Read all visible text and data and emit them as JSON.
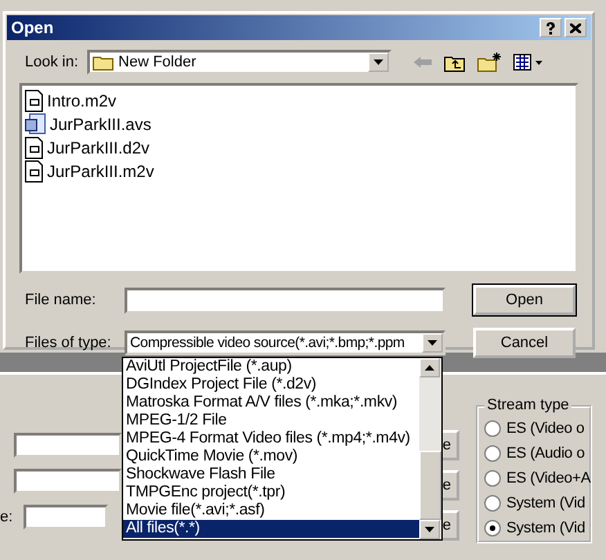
{
  "background_window": {
    "button_labels": [
      "e",
      "e",
      "e"
    ],
    "field_label": "e:",
    "stream_type": {
      "title": "Stream type",
      "options": [
        {
          "label": "ES (Video o",
          "selected": false
        },
        {
          "label": "ES (Audio o",
          "selected": false
        },
        {
          "label": "ES (Video+A",
          "selected": false
        },
        {
          "label": "System (Vid",
          "selected": false
        },
        {
          "label": "System (Vid",
          "selected": true
        }
      ]
    }
  },
  "dialog": {
    "title": "Open",
    "look_in": {
      "label": "Look in:",
      "value": "New Folder"
    },
    "files": [
      {
        "name": "Intro.m2v",
        "kind": "file"
      },
      {
        "name": "JurParkIII.avs",
        "kind": "script"
      },
      {
        "name": "JurParkIII.d2v",
        "kind": "file"
      },
      {
        "name": "JurParkIII.m2v",
        "kind": "file"
      }
    ],
    "file_name": {
      "label": "File name:"
    },
    "files_of_type": {
      "label": "Files of type:",
      "value": "Compressible video source(*.avi;*.bmp;*.ppm"
    },
    "buttons": [
      "Open",
      "Cancel"
    ],
    "type_list": [
      {
        "label": "AviUtl ProjectFile (*.aup)",
        "selected": false
      },
      {
        "label": "DGIndex Project File (*.d2v)",
        "selected": false
      },
      {
        "label": "Matroska Format A/V files (*.mka;*.mkv)",
        "selected": false
      },
      {
        "label": "MPEG-1/2 File",
        "selected": false
      },
      {
        "label": "MPEG-4 Format Video files (*.mp4;*.m4v)",
        "selected": false
      },
      {
        "label": "QuickTime Movie (*.mov)",
        "selected": false
      },
      {
        "label": "Shockwave Flash File",
        "selected": false
      },
      {
        "label": "TMPGEnc project(*.tpr)",
        "selected": false
      },
      {
        "label": "Movie file(*.avi;*.asf)",
        "selected": false
      },
      {
        "label": "All files(*.*)",
        "selected": true
      }
    ]
  }
}
